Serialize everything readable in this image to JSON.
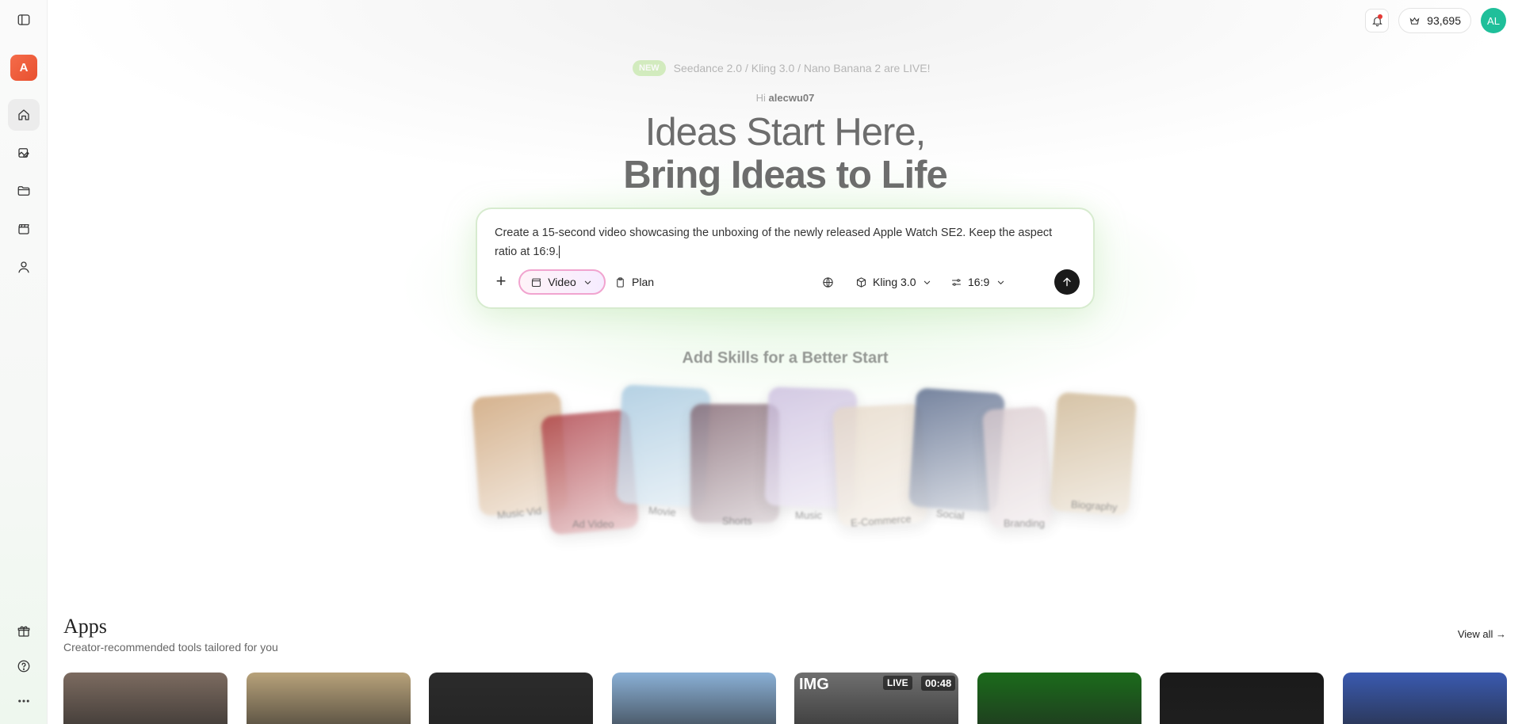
{
  "sidebar": {
    "logo_letter": "A",
    "items": [
      {
        "name": "home",
        "icon": "home-icon"
      },
      {
        "name": "assets",
        "icon": "image-edit-icon"
      },
      {
        "name": "projects",
        "icon": "folder-icon"
      },
      {
        "name": "videos",
        "icon": "clapperboard-icon"
      },
      {
        "name": "profile",
        "icon": "user-icon"
      }
    ],
    "bottom_items": [
      "gift-icon",
      "help-icon",
      "more-icon"
    ]
  },
  "topbar": {
    "credits": "93,695",
    "avatar_initials": "AL"
  },
  "announcement": {
    "badge": "NEW",
    "text": "Seedance 2.0 / Kling 3.0 / Nano Banana 2 are LIVE!"
  },
  "greeting": {
    "prefix": "Hi",
    "username": "alecwu07"
  },
  "hero": {
    "line1": "Ideas Start Here,",
    "line2": "Bring Ideas to Life"
  },
  "prompt": {
    "text": "Create a 15-second video showcasing the unboxing of the newly released Apple Watch SE2. Keep the aspect ratio at 16:9.",
    "mode_label": "Video",
    "plan_label": "Plan",
    "model_label": "Kling 3.0",
    "ratio_label": "16:9"
  },
  "skills": {
    "title": "Add Skills for a Better Start",
    "cards": [
      {
        "label": "Music Vid",
        "color": "#c89a6a"
      },
      {
        "label": "Ad Video",
        "color": "#a8323a"
      },
      {
        "label": "Movie",
        "color": "#9ec3dc"
      },
      {
        "label": "Shorts",
        "color": "#7a5c68"
      },
      {
        "label": "Music",
        "color": "#c7b9dc"
      },
      {
        "label": "E-Commerce",
        "color": "#e4d6c4"
      },
      {
        "label": "Social",
        "color": "#4a5c80"
      },
      {
        "label": "Branding",
        "color": "#d8c8cc"
      },
      {
        "label": "Biography",
        "color": "#c9b08a"
      }
    ]
  },
  "apps": {
    "title": "Apps",
    "subtitle": "Creator-recommended tools tailored for you",
    "view_all": "View all →",
    "cards": [
      {
        "color": "#7c6b60",
        "overlay": ""
      },
      {
        "color": "#b8a27a",
        "overlay": ""
      },
      {
        "color": "#2b2b2b",
        "overlay": ""
      },
      {
        "color": "#8ab0d6",
        "overlay": ""
      },
      {
        "color": "#6f6f6f",
        "overlay_left": "IMG",
        "overlay_mid": "LIVE",
        "overlay_right": "00:48"
      },
      {
        "color": "#1b6b1b",
        "overlay": ""
      },
      {
        "color": "#1a1a1a",
        "overlay": ""
      },
      {
        "color": "#3a5ab0",
        "overlay": ""
      }
    ]
  }
}
